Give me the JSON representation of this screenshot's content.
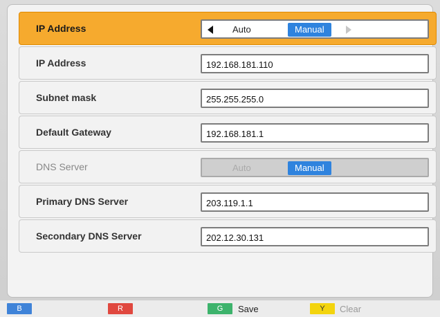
{
  "colors": {
    "active_row": "#f6aa2e",
    "toggle_selected": "#2f83de",
    "key_blue": "#3f83d8",
    "key_red": "#e0483f",
    "key_green": "#3db36c",
    "key_yellow": "#f3d40e"
  },
  "rows": [
    {
      "label": "IP Address",
      "toggle": {
        "left_arrow": "left-arrow-icon",
        "option_auto": "Auto",
        "option_manual": "Manual",
        "selected": "Manual",
        "right_arrow": "right-arrow-icon"
      }
    },
    {
      "label": "IP Address",
      "value": "192.168.181.110"
    },
    {
      "label": "Subnet mask",
      "value": "255.255.255.0"
    },
    {
      "label": "Default Gateway",
      "value": "192.168.181.1"
    },
    {
      "label": "DNS Server",
      "toggle": {
        "option_auto": "Auto",
        "option_manual": "Manual",
        "selected": "Manual"
      }
    },
    {
      "label": "Primary DNS Server",
      "value": "203.119.1.1"
    },
    {
      "label": "Secondary DNS Server",
      "value": "202.12.30.131"
    }
  ],
  "footer": {
    "blue_key": "B",
    "red_key": "R",
    "green_key": "G",
    "green_label": "Save",
    "yellow_key": "Y",
    "yellow_label": "Clear"
  }
}
